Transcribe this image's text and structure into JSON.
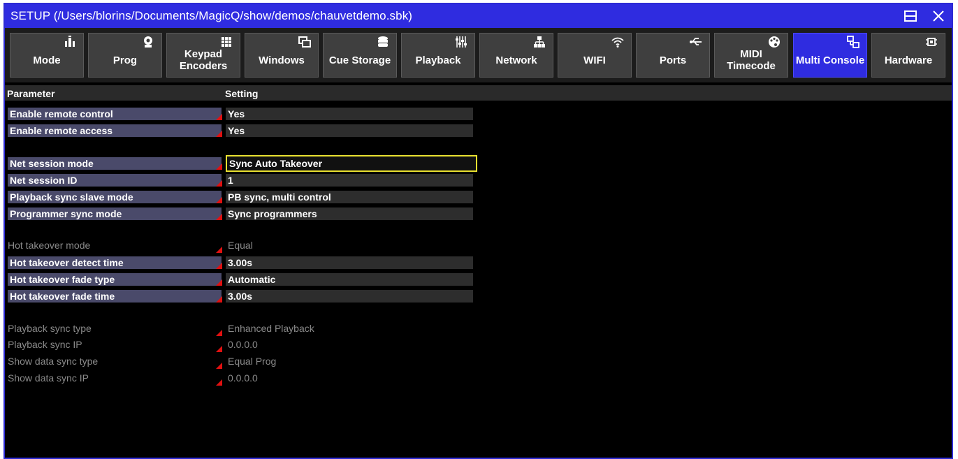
{
  "title": "SETUP (/Users/blorins/Documents/MagicQ/show/demos/chauvetdemo.sbk)",
  "tabs": [
    {
      "label": "Mode",
      "icon": "mode-icon",
      "active": false
    },
    {
      "label": "Prog",
      "icon": "prog-icon",
      "active": false
    },
    {
      "label": "Keypad\nEncoders",
      "icon": "keypad-icon",
      "active": false
    },
    {
      "label": "Windows",
      "icon": "windows-icon",
      "active": false
    },
    {
      "label": "Cue Storage",
      "icon": "storage-icon",
      "active": false
    },
    {
      "label": "Playback",
      "icon": "faders-icon",
      "active": false
    },
    {
      "label": "Network",
      "icon": "network-icon",
      "active": false
    },
    {
      "label": "WIFI",
      "icon": "wifi-icon",
      "active": false
    },
    {
      "label": "Ports",
      "icon": "usb-icon",
      "active": false
    },
    {
      "label": "MIDI\nTimecode",
      "icon": "palette-icon",
      "active": false
    },
    {
      "label": "Multi Console",
      "icon": "multi-console-icon",
      "active": true
    },
    {
      "label": "Hardware",
      "icon": "chip-icon",
      "active": false
    }
  ],
  "table": {
    "header_parameter": "Parameter",
    "header_setting": "Setting",
    "rows": [
      {
        "param": "Enable remote control",
        "value": "Yes",
        "enabled": true
      },
      {
        "param": "Enable remote access",
        "value": "Yes",
        "enabled": true
      },
      {
        "param": "Net session mode",
        "value": "Sync Auto Takeover",
        "enabled": true,
        "selected": true
      },
      {
        "param": "Net session ID",
        "value": "1",
        "enabled": true
      },
      {
        "param": "Playback sync slave mode",
        "value": "PB sync, multi control",
        "enabled": true
      },
      {
        "param": "Programmer sync mode",
        "value": "Sync programmers",
        "enabled": true
      },
      {
        "param": "Hot takeover mode",
        "value": "Equal",
        "enabled": false
      },
      {
        "param": "Hot takeover detect time",
        "value": "3.00s",
        "enabled": true
      },
      {
        "param": "Hot takeover fade type",
        "value": "Automatic",
        "enabled": true
      },
      {
        "param": "Hot takeover fade time",
        "value": "3.00s",
        "enabled": true
      },
      {
        "param": "Playback sync type",
        "value": "Enhanced Playback",
        "enabled": false
      },
      {
        "param": "Playback sync IP",
        "value": "0.0.0.0",
        "enabled": false
      },
      {
        "param": "Show data sync type",
        "value": "Equal Prog",
        "enabled": false
      },
      {
        "param": "Show data sync IP",
        "value": "0.0.0.0",
        "enabled": false
      }
    ]
  },
  "colors": {
    "accent": "#2f2ce0",
    "selection": "#e8e030",
    "marker": "#e01010"
  }
}
